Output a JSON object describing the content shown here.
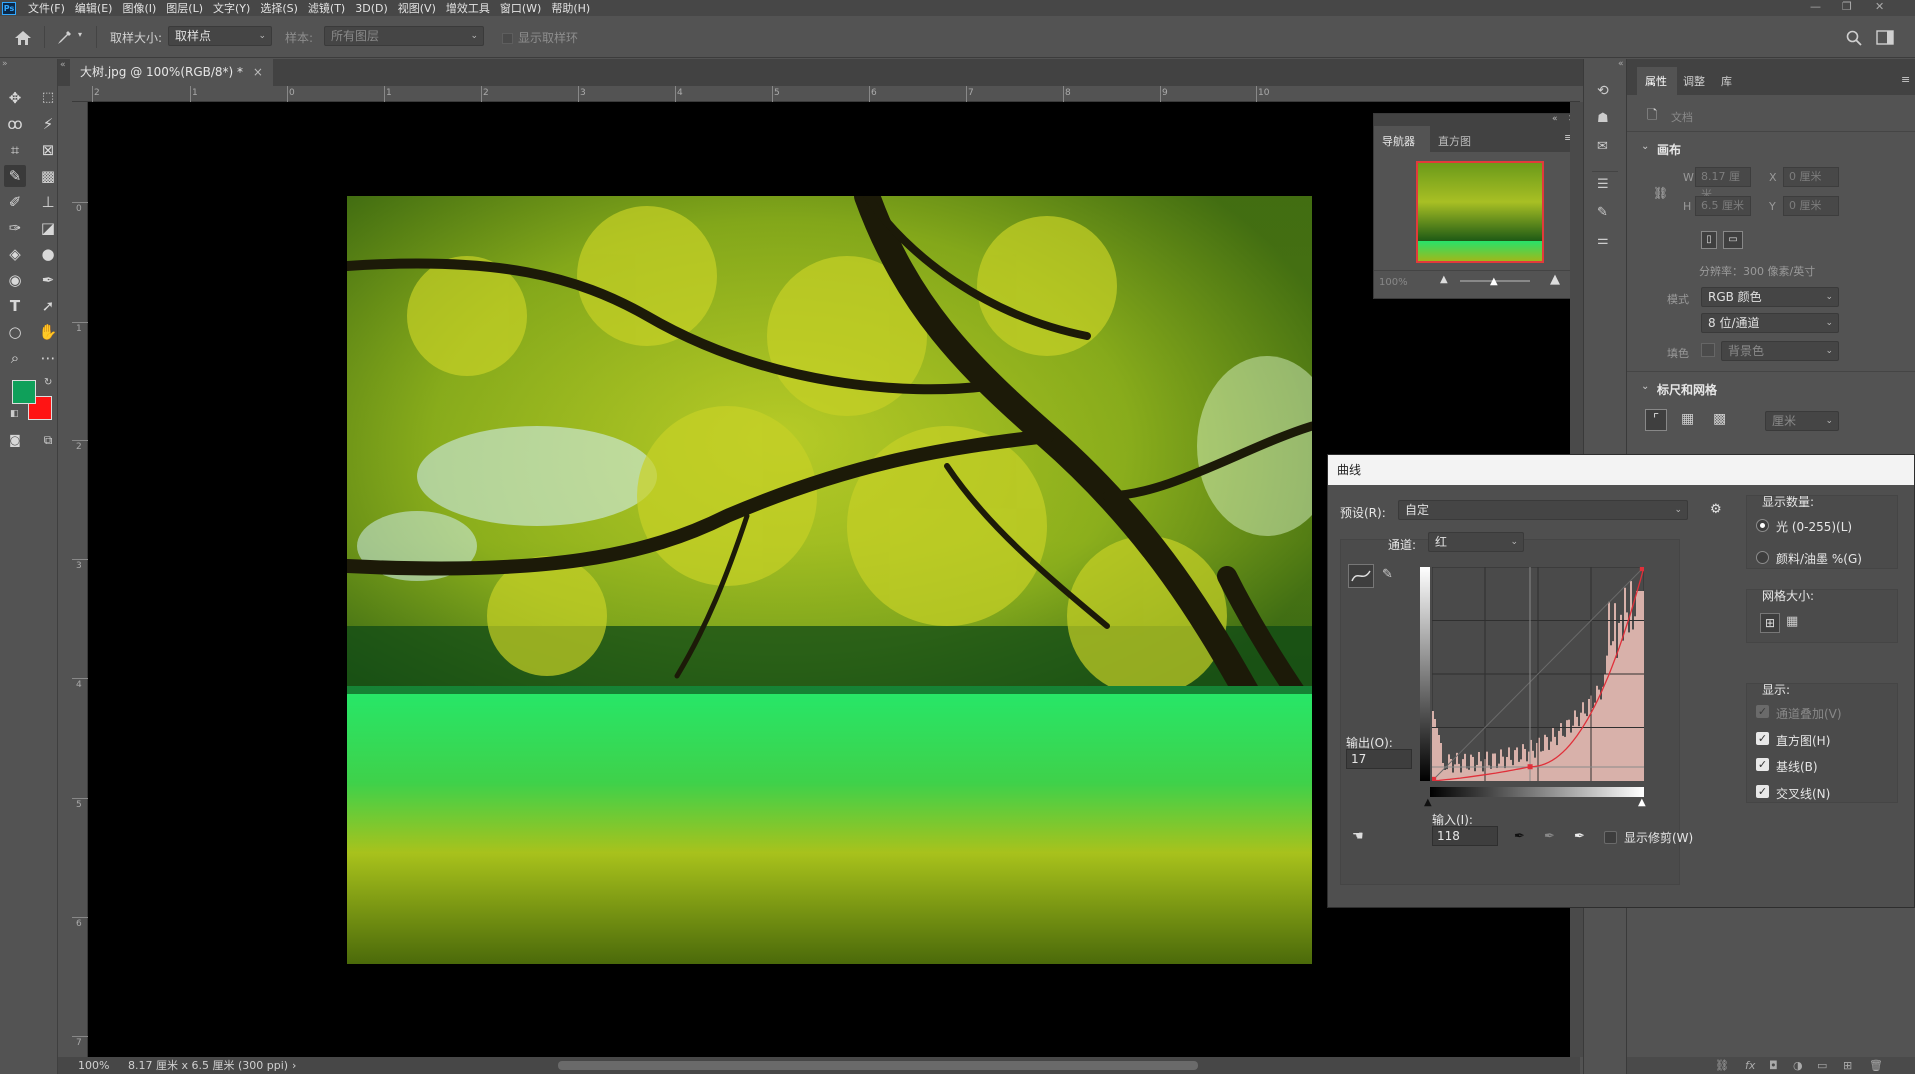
{
  "menubar": {
    "logo": "Ps",
    "items": [
      "文件(F)",
      "编辑(E)",
      "图像(I)",
      "图层(L)",
      "文字(Y)",
      "选择(S)",
      "滤镜(T)",
      "3D(D)",
      "视图(V)",
      "增效工具",
      "窗口(W)",
      "帮助(H)"
    ]
  },
  "options": {
    "sample_size_label": "取样大小:",
    "sample_size_value": "取样点",
    "sample_label": "样本:",
    "sample_value": "所有图层",
    "show_ring_label": "显示取样环"
  },
  "document": {
    "tab_title": "大树.jpg @ 100%(RGB/8*) *",
    "tab_close": "×"
  },
  "ruler": {
    "h_ticks": [
      "2",
      "1",
      "0",
      "1",
      "2",
      "3",
      "4",
      "5",
      "6",
      "7",
      "8",
      "9",
      "10"
    ],
    "v_ticks": [
      "0",
      "1",
      "2",
      "3",
      "4",
      "5",
      "6",
      "7"
    ]
  },
  "status": {
    "zoom": "100%",
    "dimensions": "8.17 厘米 x 6.5 厘米 (300 ppi)",
    "arrow": "›"
  },
  "navigator": {
    "tab_navigator": "导航器",
    "tab_histogram": "直方图",
    "zoom": "100%"
  },
  "properties": {
    "tab_properties": "属性",
    "tab_adjust": "调整",
    "tab_library": "库",
    "doc_label": "文档",
    "canvas_heading": "画布",
    "w_label": "W",
    "w_value": "8.17 厘米",
    "h_label": "H",
    "h_value": "6.5 厘米",
    "x_label": "X",
    "x_value": "0 厘米",
    "y_label": "Y",
    "y_value": "0 厘米",
    "resolution": "分辨率：300 像素/英寸",
    "mode_label": "模式",
    "mode_value": "RGB 颜色",
    "depth_value": "8 位/通道",
    "fill_label": "填色",
    "fill_value": "背景色",
    "rulers_heading": "标尺和网格",
    "unit_value": "厘米"
  },
  "curves": {
    "title": "曲线",
    "preset_label": "预设(R):",
    "preset_value": "自定",
    "channel_label": "通道:",
    "channel_value": "红",
    "output_label": "输出(O):",
    "output_value": "17",
    "input_label": "输入(I):",
    "input_value": "118",
    "show_clipping": "显示修剪(W)",
    "show_amount_heading": "显示数量:",
    "light_option": "光 (0-255)(L)",
    "pigment_option": "颜料/油墨 %(G)",
    "grid_size_heading": "网格大小:",
    "show_heading": "显示:",
    "channel_overlay": "通道叠加(V)",
    "histogram_option": "直方图(H)",
    "baseline_option": "基线(B)",
    "intersection_option": "交叉线(N)"
  },
  "colors": {
    "foreground": "#0fa05a",
    "background": "#ff1414",
    "curve": "#e0303a",
    "histogram": "#d8b1aa"
  },
  "icons": [
    "home-icon",
    "eyedropper-icon",
    "search-icon",
    "move-tool-icon",
    "marquee-tool-icon",
    "lasso-tool-icon",
    "magic-wand-icon",
    "crop-tool-icon",
    "frame-tool-icon",
    "eyedropper-tool-icon",
    "healing-brush-icon",
    "brush-tool-icon",
    "stamp-tool-icon",
    "history-brush-icon",
    "eraser-icon",
    "paint-bucket-icon",
    "blur-tool-icon",
    "dodge-tool-icon",
    "pen-tool-icon",
    "type-tool-icon",
    "path-select-icon",
    "ellipse-tool-icon",
    "hand-tool-icon",
    "zoom-tool-icon",
    "more-tools-icon"
  ]
}
